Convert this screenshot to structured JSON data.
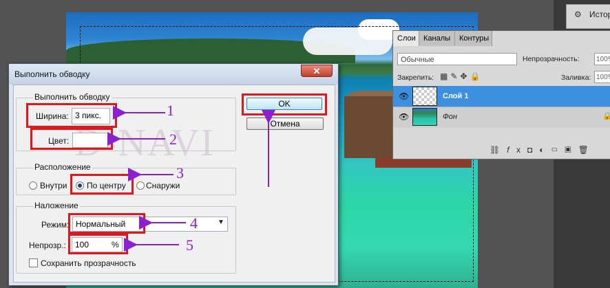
{
  "workspace": {
    "history_label": "Истор"
  },
  "layers_panel": {
    "tabs": [
      "Слои",
      "Каналы",
      "Контуры"
    ],
    "blend_mode": "Обычные",
    "opacity_label": "Непрозрачность:",
    "opacity_value": "100%",
    "lock_label": "Закрепить:",
    "fill_label": "Заливка:",
    "fill_value": "100%",
    "layers": [
      {
        "name": "Слой 1",
        "selected": true
      },
      {
        "name": "Фон",
        "selected": false
      }
    ],
    "footer_icons": [
      "link-icon",
      "fx-icon",
      "mask-icon",
      "adjustment-icon",
      "group-icon",
      "new-layer-icon",
      "trash-icon"
    ]
  },
  "dialog": {
    "title": "Выполнить обводку",
    "close_symbol": "✕",
    "stroke_group": {
      "legend": "Выполнить обводку",
      "width_label": "Ширина:",
      "width_value": "3 пикс.",
      "color_label": "Цвет:"
    },
    "location_group": {
      "legend": "Расположение",
      "options": [
        "Внутри",
        "По центру",
        "Снаружи"
      ],
      "selected": "По центру"
    },
    "blend_group": {
      "legend": "Наложение",
      "mode_label": "Режим:",
      "mode_value": "Нормальный",
      "opacity_label": "Непрозр.:",
      "opacity_value": "100",
      "opacity_unit": "%",
      "preserve_label": "Сохранить прозрачность"
    },
    "ok_label": "OK",
    "cancel_label": "Отмена"
  },
  "watermark": "D-NAVI",
  "callouts": [
    "1",
    "2",
    "3",
    "4",
    "5"
  ],
  "colors": {
    "highlight_red": "#e2161c",
    "arrow_purple": "#8b1fd2",
    "selected_layer": "#3d8fe0"
  }
}
